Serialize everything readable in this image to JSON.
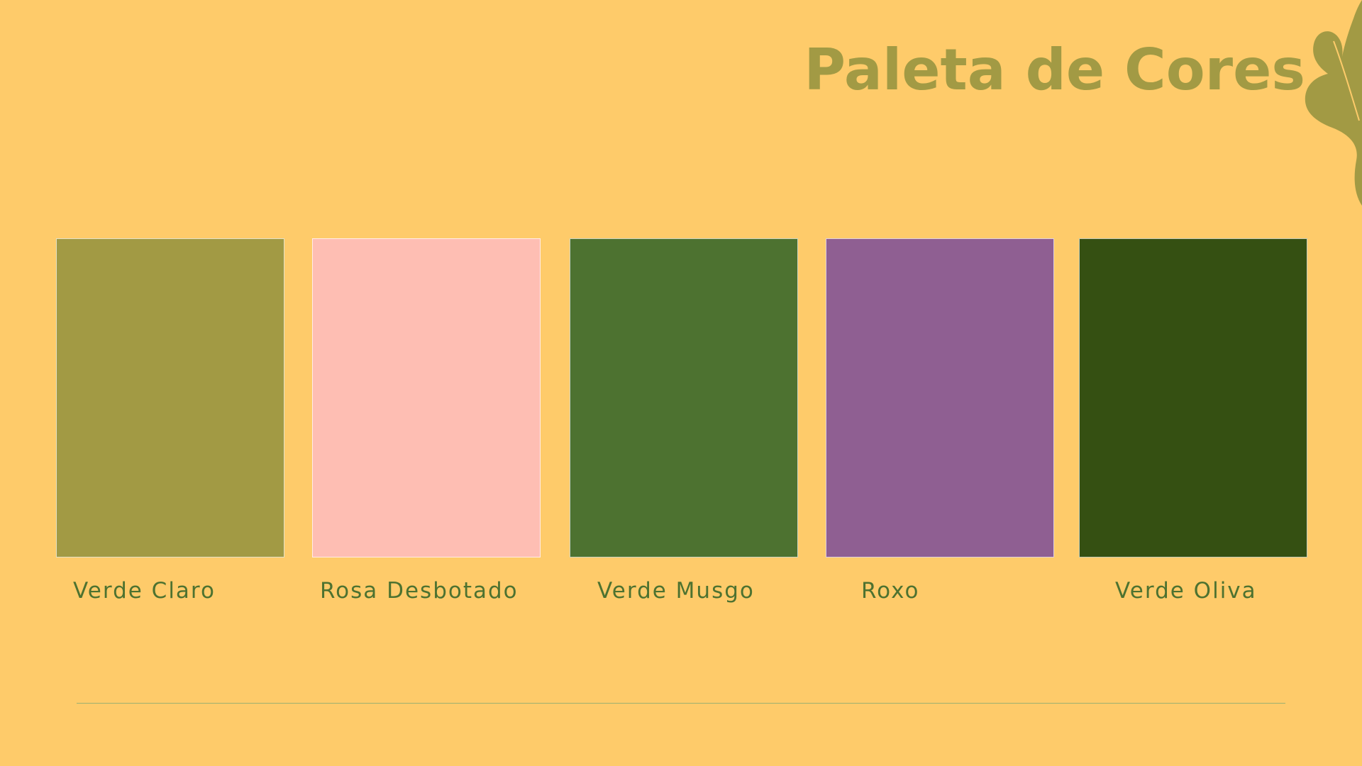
{
  "title": "Paleta de Cores",
  "swatches": [
    {
      "label": "Verde Claro",
      "color": "#A29A44"
    },
    {
      "label": "Rosa Desbotado",
      "color": "#FEBEB3"
    },
    {
      "label": "Verde Musgo",
      "color": "#4D7230"
    },
    {
      "label": "Roxo",
      "color": "#8F5F92"
    },
    {
      "label": "Verde Oliva",
      "color": "#355012"
    }
  ],
  "colors": {
    "background": "#FECB6A",
    "title": "#A29A44",
    "label": "#4D7230",
    "divider": "#9CB071",
    "leaf": "#A29A44"
  },
  "decoration": "leaf-icon"
}
